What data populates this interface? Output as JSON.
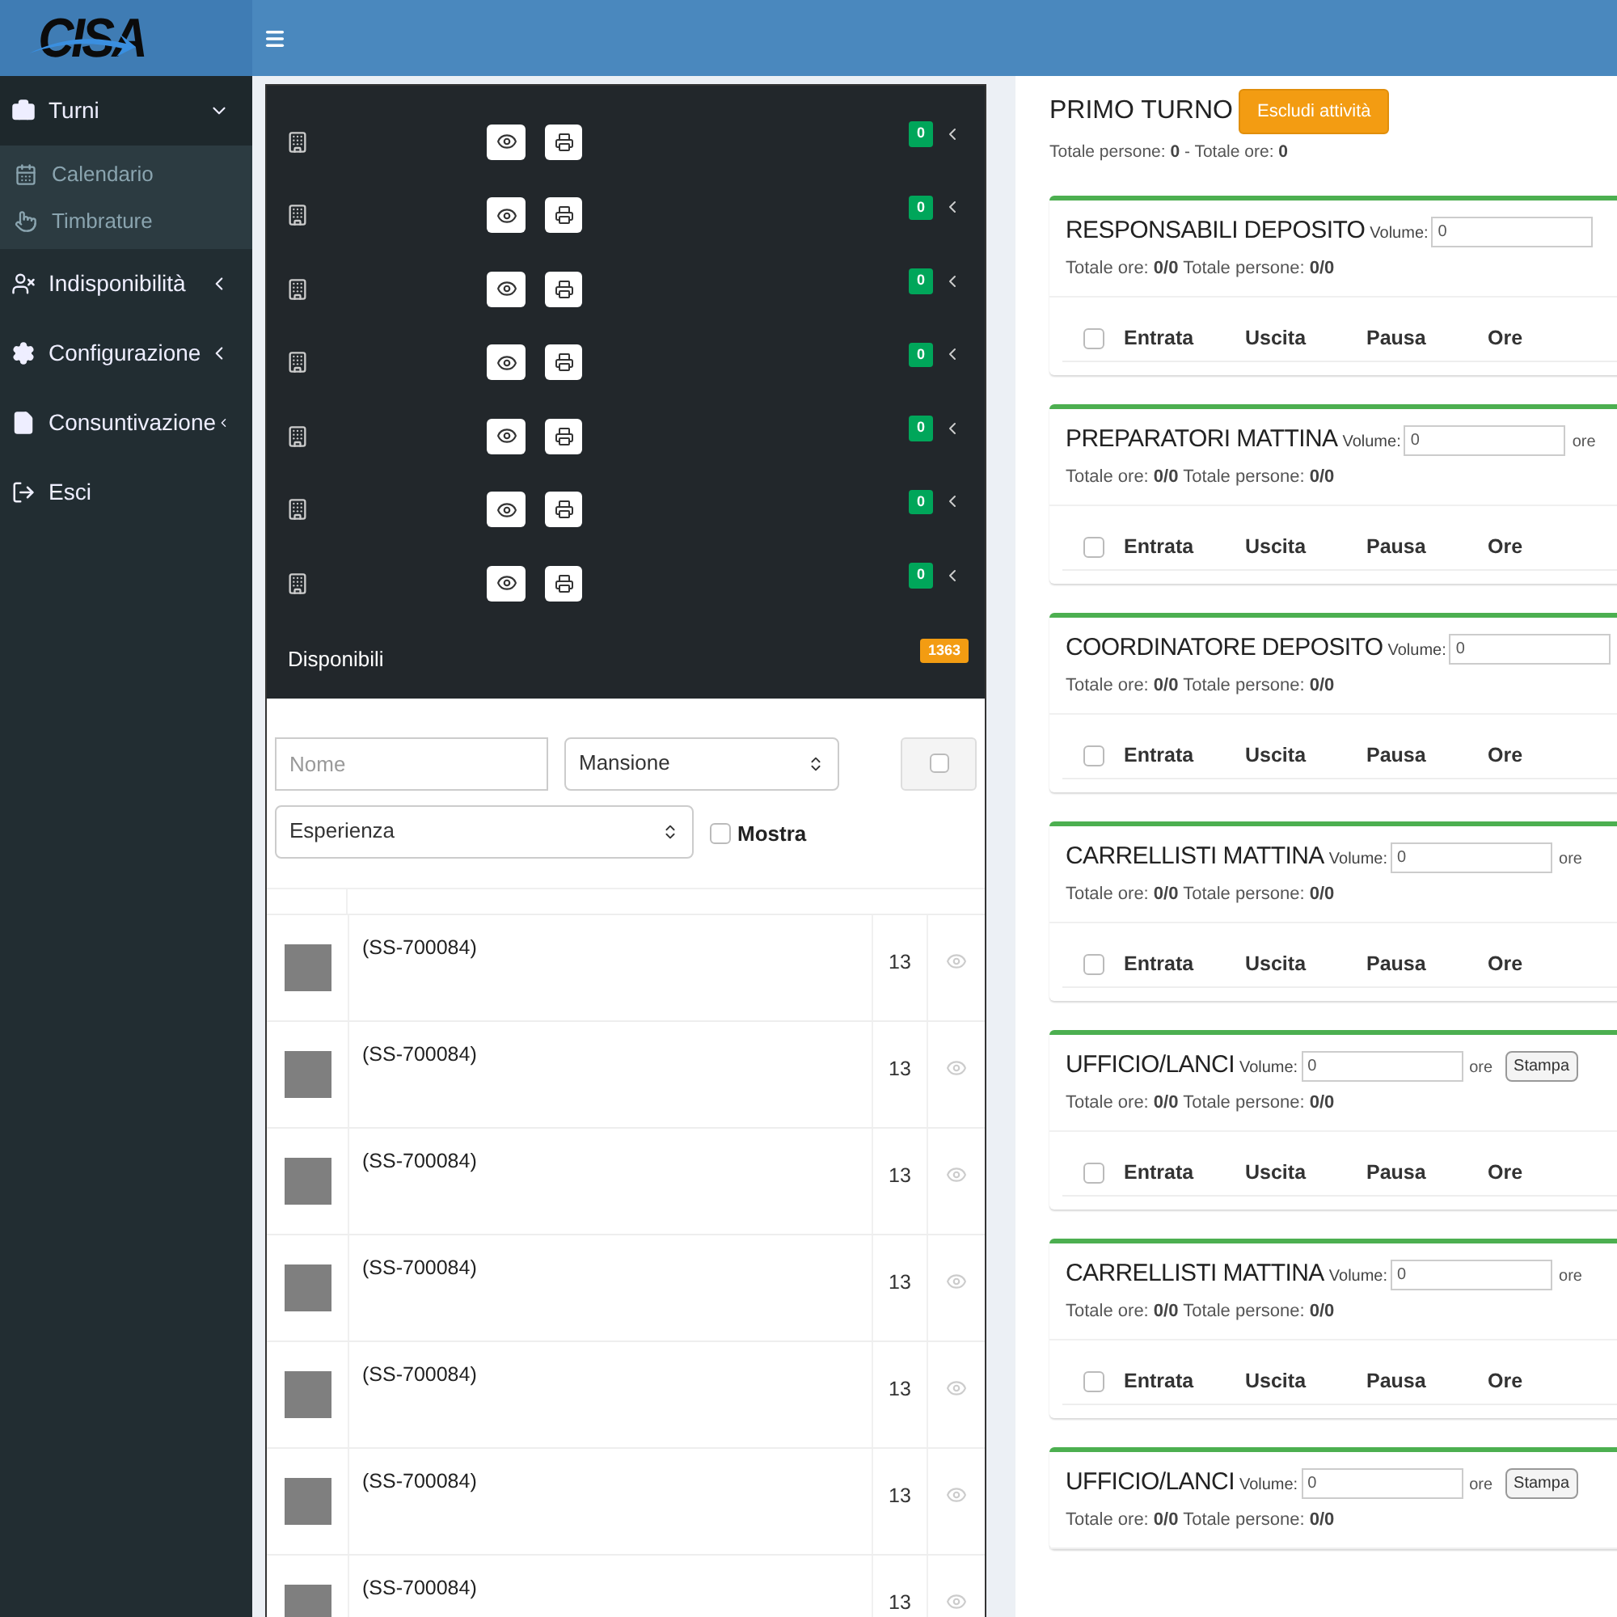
{
  "logo": "CISA",
  "sidebar": {
    "items": [
      {
        "label": "Turni",
        "expanded": true,
        "children": [
          {
            "label": "Calendario"
          },
          {
            "label": "Timbrature"
          }
        ]
      },
      {
        "label": "Indisponibilità",
        "expanded": false
      },
      {
        "label": "Configurazione",
        "expanded": false
      },
      {
        "label": "Consuntivazione",
        "expanded": false
      },
      {
        "label": "Esci"
      }
    ]
  },
  "sites": [
    {
      "count": "0"
    },
    {
      "count": "0"
    },
    {
      "count": "0"
    },
    {
      "count": "0"
    },
    {
      "count": "0"
    },
    {
      "count": "0"
    },
    {
      "count": "0"
    }
  ],
  "available": {
    "label": "Disponibili",
    "count": "1363"
  },
  "filters": {
    "name_placeholder": "Nome",
    "mansione": "Mansione",
    "esperienza": "Esperienza",
    "show": {
      "label": "Mostra",
      "checked": false
    }
  },
  "workers": [
    {
      "code": "(SS-700084)",
      "count": "13"
    },
    {
      "code": "(SS-700084)",
      "count": "13"
    },
    {
      "code": "(SS-700084)",
      "count": "13"
    },
    {
      "code": "(SS-700084)",
      "count": "13"
    },
    {
      "code": "(SS-700084)",
      "count": "13"
    },
    {
      "code": "(SS-700084)",
      "count": "13"
    },
    {
      "code": "(SS-700084)",
      "count": "13"
    }
  ],
  "shift": {
    "title": "PRIMO TURNO",
    "button": "Escludi attività",
    "totals": "Totale persone: **0** - Totale ore: **0**"
  },
  "sections": [
    {
      "title": "RESPONSABILI DEPOSITO",
      "volume_label": "Volume:",
      "volume": "0",
      "totals": "Totale ore: **0/0** Totale persone: **0/0**",
      "checked": false,
      "columns": [
        "Entrata",
        "Uscita",
        "Pausa",
        "Ore"
      ]
    },
    {
      "title": "PREPARATORI MATTINA",
      "volume_label": "Volume:",
      "volume": "0",
      "unit": "ore",
      "totals": "Totale ore: **0/0** Totale persone: **0/0**",
      "checked": false,
      "columns": [
        "Entrata",
        "Uscita",
        "Pausa",
        "Ore"
      ]
    },
    {
      "title": "COORDINATORE DEPOSITO",
      "volume_label": "Volume:",
      "volume": "0",
      "totals": "Totale ore: **0/0** Totale persone: **0/0**",
      "checked": false,
      "columns": [
        "Entrata",
        "Uscita",
        "Pausa",
        "Ore"
      ]
    },
    {
      "title": "CARRELLISTI MATTINA",
      "volume_label": "Volume:",
      "volume": "0",
      "unit": "ore",
      "totals": "Totale ore: **0/0** Totale persone: **0/0**",
      "checked": false,
      "columns": [
        "Entrata",
        "Uscita",
        "Pausa",
        "Ore"
      ]
    },
    {
      "title": "UFFICIO/LANCI",
      "volume_label": "Volume:",
      "volume": "0",
      "unit": "ore",
      "button": "Stampa",
      "totals": "Totale ore: **0/0** Totale persone: **0/0**",
      "checked": false,
      "columns": [
        "Entrata",
        "Uscita",
        "Pausa",
        "Ore"
      ]
    },
    {
      "title": "CARRELLISTI MATTINA",
      "volume_label": "Volume:",
      "volume": "0",
      "unit": "ore",
      "totals": "Totale ore: **0/0** Totale persone: **0/0**",
      "checked": false,
      "columns": [
        "Entrata",
        "Uscita",
        "Pausa",
        "Ore"
      ]
    },
    {
      "title": "UFFICIO/LANCI",
      "volume_label": "Volume:",
      "volume": "0",
      "unit": "ore",
      "button": "Stampa",
      "totals": "Totale ore: **0/0** Totale persone: **0/0**"
    }
  ]
}
